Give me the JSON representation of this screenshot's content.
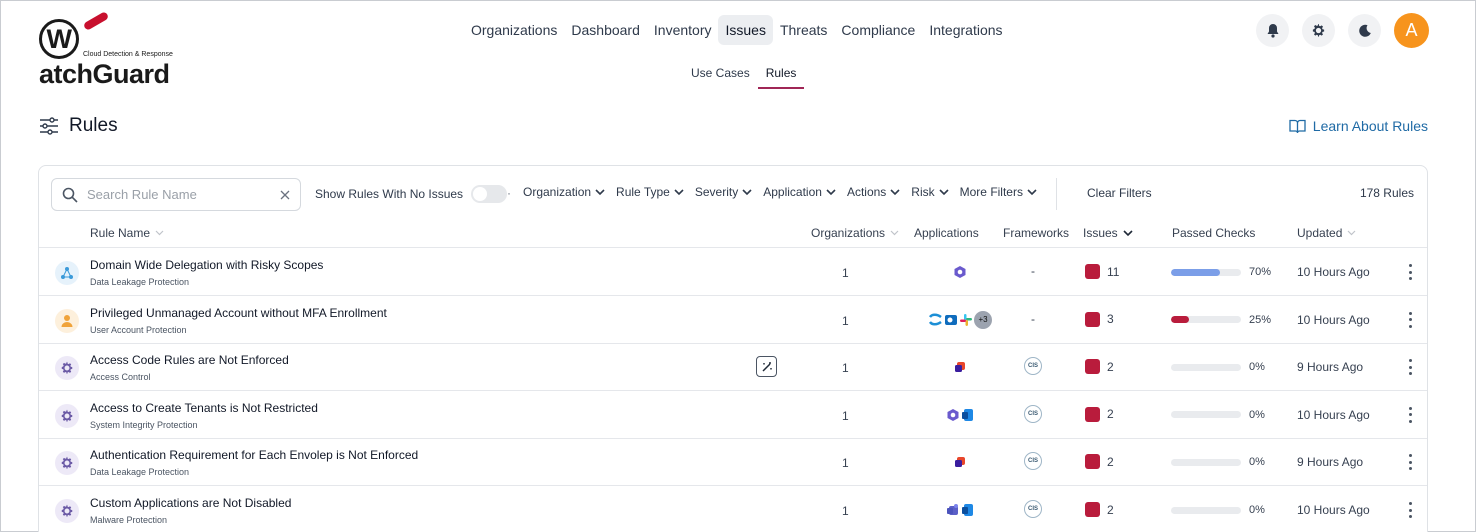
{
  "brand": {
    "name": "WatchGuard",
    "tagline": "Cloud Detection & Response"
  },
  "nav": {
    "items": [
      {
        "label": "Organizations",
        "active": false
      },
      {
        "label": "Dashboard",
        "active": false
      },
      {
        "label": "Inventory",
        "active": false
      },
      {
        "label": "Issues",
        "active": true
      },
      {
        "label": "Threats",
        "active": false
      },
      {
        "label": "Compliance",
        "active": false
      },
      {
        "label": "Integrations",
        "active": false
      }
    ],
    "avatar_initial": "A"
  },
  "subnav": {
    "items": [
      {
        "label": "Use Cases",
        "active": false
      },
      {
        "label": "Rules",
        "active": true
      }
    ]
  },
  "page": {
    "title": "Rules",
    "learn_link": "Learn About Rules"
  },
  "filters": {
    "search_placeholder": "Search Rule Name",
    "toggle_label": "Show Rules With No Issues",
    "toggle_on": false,
    "separator": "·",
    "dropdowns": [
      "Organization",
      "Rule Type",
      "Severity",
      "Application",
      "Actions",
      "Risk",
      "More Filters"
    ],
    "clear_label": "Clear Filters",
    "count_label": "178 Rules"
  },
  "table": {
    "headers": {
      "rule_name": "Rule Name",
      "organizations": "Organizations",
      "applications": "Applications",
      "frameworks": "Frameworks",
      "issues": "Issues",
      "passed_checks": "Passed Checks",
      "updated": "Updated"
    },
    "rows": [
      {
        "name": "Domain Wide Delegation with Risky Scopes",
        "category": "Data Leakage Protection",
        "icon": "share-nodes-icon",
        "orgs": "1",
        "apps": [
          "google-workspace-icon"
        ],
        "apps_more": "",
        "framework": "-",
        "issues": "11",
        "passed_pct": 70,
        "passed_label": "70%",
        "bar_color": "#7b9ee8",
        "updated": "10 Hours Ago",
        "magic": false
      },
      {
        "name": "Privileged Unmanaged Account without MFA Enrollment",
        "category": "User Account Protection",
        "icon": "user-icon",
        "orgs": "1",
        "apps": [
          "confluence-icon",
          "outlook-icon",
          "slack-icon"
        ],
        "apps_more": "+3",
        "framework": "-",
        "issues": "3",
        "passed_pct": 25,
        "passed_label": "25%",
        "bar_color": "#b91c3c",
        "updated": "10 Hours Ago",
        "magic": false
      },
      {
        "name": "Access Code Rules are Not Enforced",
        "category": "Access Control",
        "icon": "gear-icon",
        "orgs": "1",
        "apps": [
          "m365-icon"
        ],
        "apps_more": "",
        "framework": "CIS",
        "issues": "2",
        "passed_pct": 0,
        "passed_label": "0%",
        "bar_color": "#b91c3c",
        "updated": "9 Hours Ago",
        "magic": true
      },
      {
        "name": "Access to Create Tenants is Not Restricted",
        "category": "System Integrity Protection",
        "icon": "gear-icon",
        "orgs": "1",
        "apps": [
          "google-workspace-icon",
          "onedrive-icon"
        ],
        "apps_more": "",
        "framework": "CIS",
        "issues": "2",
        "passed_pct": 0,
        "passed_label": "0%",
        "bar_color": "#b91c3c",
        "updated": "10 Hours Ago",
        "magic": false
      },
      {
        "name": "Authentication Requirement for Each Envolep is Not Enforced",
        "category": "Data Leakage Protection",
        "icon": "gear-icon",
        "orgs": "1",
        "apps": [
          "m365-icon"
        ],
        "apps_more": "",
        "framework": "CIS",
        "issues": "2",
        "passed_pct": 0,
        "passed_label": "0%",
        "bar_color": "#b91c3c",
        "updated": "9 Hours Ago",
        "magic": false
      },
      {
        "name": "Custom Applications are Not Disabled",
        "category": "Malware Protection",
        "icon": "gear-icon",
        "orgs": "1",
        "apps": [
          "teams-icon",
          "onedrive-icon"
        ],
        "apps_more": "",
        "framework": "CIS",
        "issues": "2",
        "passed_pct": 0,
        "passed_label": "0%",
        "bar_color": "#b91c3c",
        "updated": "10 Hours Ago",
        "magic": false
      }
    ]
  },
  "colors": {
    "accent": "#a02656",
    "link": "#1f6aa5",
    "severity_high": "#b91c3c",
    "avatar": "#f7941d",
    "gear_bg": "#ede9f7",
    "gear": "#6b5aa6"
  }
}
